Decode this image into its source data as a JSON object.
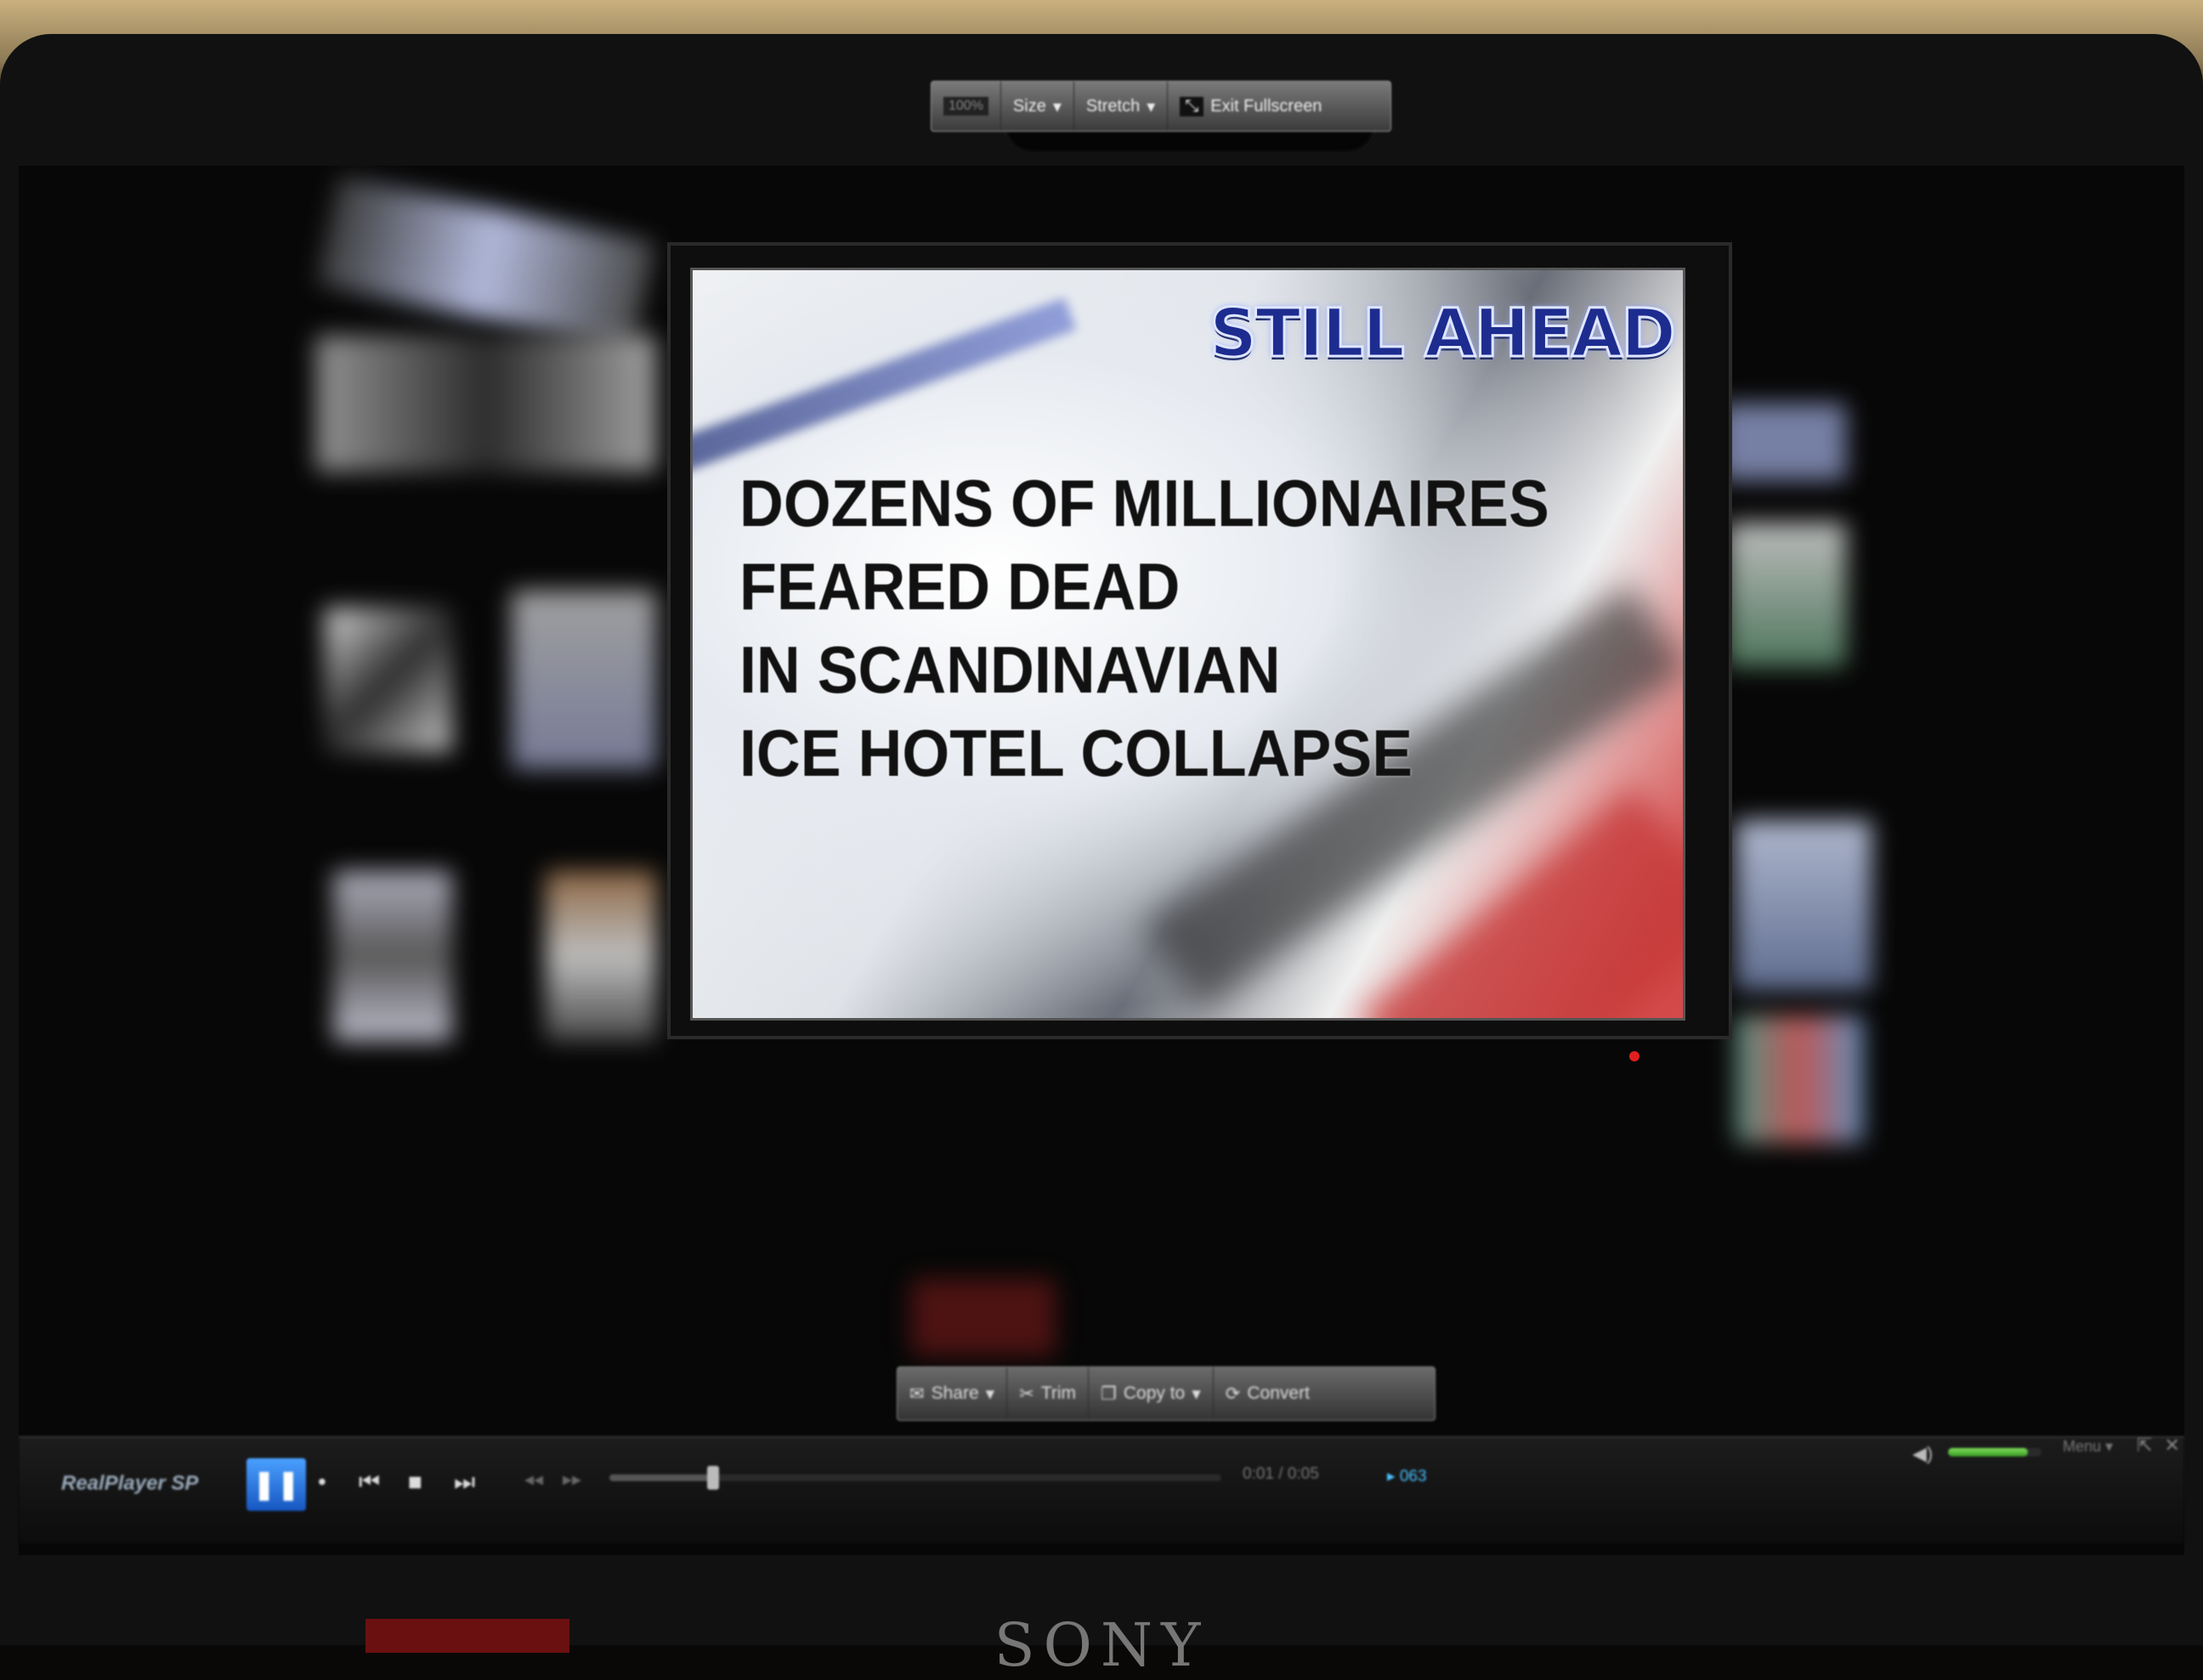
{
  "monitor": {
    "brand": "SONY"
  },
  "toolbar_top": {
    "zoom": "100%",
    "size_label": "Size",
    "stretch_label": "Stretch",
    "exit_fullscreen_label": "Exit Fullscreen"
  },
  "video": {
    "banner": "STILL AHEAD",
    "headline": [
      "DOZENS OF MILLIONAIRES",
      "FEARED DEAD",
      "IN SCANDINAVIAN",
      "ICE HOTEL COLLAPSE"
    ]
  },
  "toolbar_bottom": {
    "share_label": "Share",
    "trim_label": "Trim",
    "copy_to_label": "Copy to",
    "convert_label": "Convert"
  },
  "player": {
    "logo": "RealPlayer SP",
    "time": "0:01 / 0:05",
    "rate": "063",
    "menu_label": "Menu",
    "seek_progress": 0.17,
    "volume_level": 0.85
  }
}
